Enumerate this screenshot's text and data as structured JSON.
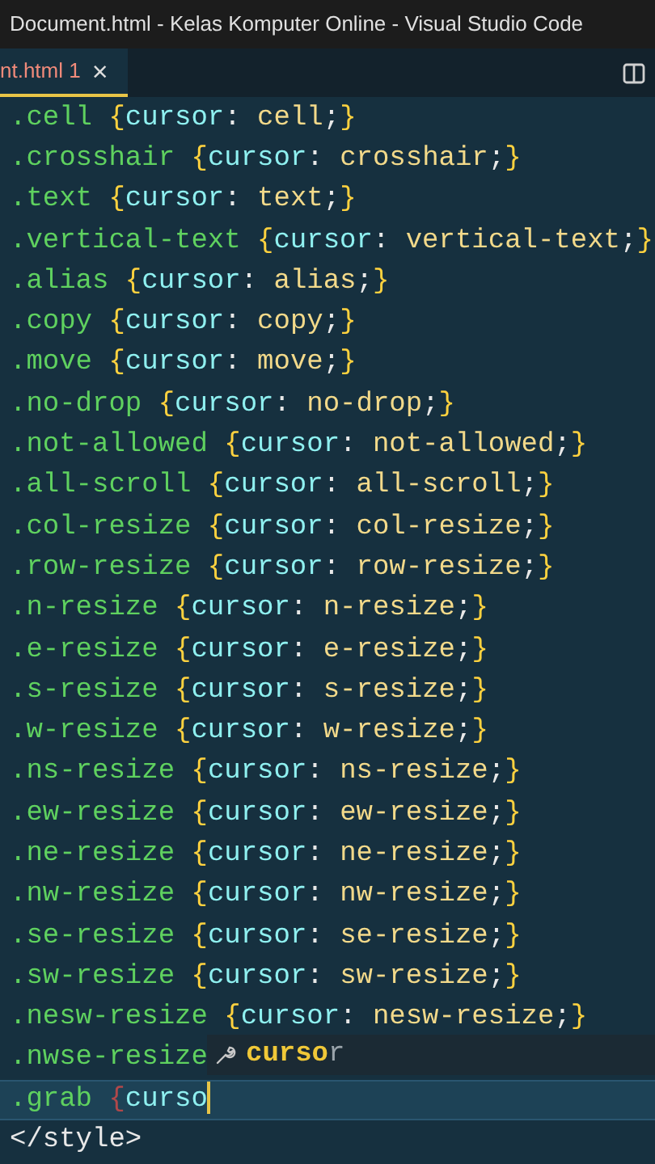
{
  "window": {
    "title": "Document.html - Kelas Komputer Online - Visual Studio Code"
  },
  "tab": {
    "label": "nt.html",
    "problems": "1",
    "close": "×",
    "selected": true
  },
  "editor": {
    "lines": [
      {
        "kind": "rule",
        "text": ".cell {cursor: cell;}"
      },
      {
        "kind": "rule",
        "text": ".crosshair {cursor: crosshair;}"
      },
      {
        "kind": "rule",
        "text": ".text {cursor: text;}"
      },
      {
        "kind": "rule",
        "text": ".vertical-text {cursor: vertical-text;}"
      },
      {
        "kind": "rule",
        "text": ".alias {cursor: alias;}"
      },
      {
        "kind": "rule",
        "text": ".copy {cursor: copy;}"
      },
      {
        "kind": "rule",
        "text": ".move {cursor: move;}"
      },
      {
        "kind": "rule",
        "text": ".no-drop {cursor: no-drop;}"
      },
      {
        "kind": "rule",
        "text": ".not-allowed {cursor: not-allowed;}"
      },
      {
        "kind": "rule",
        "text": ".all-scroll {cursor: all-scroll;}"
      },
      {
        "kind": "rule",
        "text": ".col-resize {cursor: col-resize;}"
      },
      {
        "kind": "rule",
        "text": ".row-resize {cursor: row-resize;}"
      },
      {
        "kind": "rule",
        "text": ".n-resize {cursor: n-resize;}"
      },
      {
        "kind": "rule",
        "text": ".e-resize {cursor: e-resize;}"
      },
      {
        "kind": "rule",
        "text": ".s-resize {cursor: s-resize;}"
      },
      {
        "kind": "rule",
        "text": ".w-resize {cursor: w-resize;}"
      },
      {
        "kind": "rule",
        "text": ".ns-resize {cursor: ns-resize;}"
      },
      {
        "kind": "rule",
        "text": ".ew-resize {cursor: ew-resize;}"
      },
      {
        "kind": "rule",
        "text": ".ne-resize {cursor: ne-resize;}"
      },
      {
        "kind": "rule",
        "text": ".nw-resize {cursor: nw-resize;}"
      },
      {
        "kind": "rule",
        "text": ".se-resize {cursor: se-resize;}"
      },
      {
        "kind": "rule",
        "text": ".sw-resize {cursor: sw-resize;}"
      },
      {
        "kind": "rule",
        "text": ".nesw-resize {cursor: nesw-resize;}"
      },
      {
        "kind": "rule",
        "text": ".nwse-resize"
      },
      {
        "kind": "rule",
        "text": ".grab {curso",
        "current": true
      },
      {
        "kind": "tag",
        "text": "</style>"
      }
    ]
  },
  "suggest": {
    "match": "curso",
    "rest": "r"
  }
}
